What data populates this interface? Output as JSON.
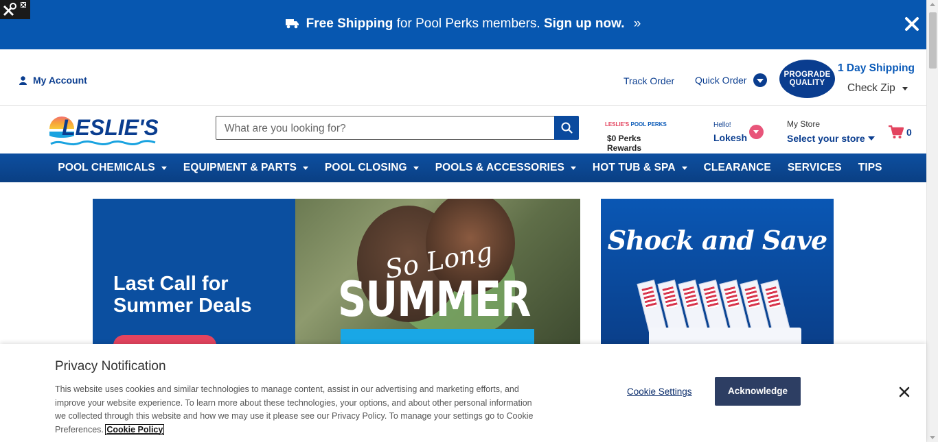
{
  "promo": {
    "free_shipping": "Free Shipping",
    "members_text": "for Pool Perks members.",
    "signup": "Sign up now.",
    "arrows": "»"
  },
  "utility": {
    "my_account": "My Account",
    "track_order": "Track Order",
    "quick_order": "Quick Order",
    "prograde_line1": "PROGRADE",
    "prograde_line2": "QUALITY",
    "one_day_shipping": "1 Day Shipping",
    "check_zip": "Check Zip"
  },
  "header": {
    "logo_text": "LESLIE'S",
    "search_placeholder": "What are you looking for?",
    "perks_brand_prefix": "LESLIE'S",
    "perks_brand_suffix": "POOL PERKS",
    "perks_rewards": "$0 Perks Rewards",
    "hello": "Hello!",
    "username": "Lokesh",
    "my_store": "My Store",
    "select_store": "Select your store",
    "cart_count": "0"
  },
  "nav": {
    "items": [
      {
        "label": "POOL CHEMICALS",
        "dropdown": true
      },
      {
        "label": "EQUIPMENT & PARTS",
        "dropdown": true
      },
      {
        "label": "POOL CLOSING",
        "dropdown": true
      },
      {
        "label": "POOLS & ACCESSORIES",
        "dropdown": true
      },
      {
        "label": "HOT TUB & SPA",
        "dropdown": true
      },
      {
        "label": "CLEARANCE",
        "dropdown": false
      },
      {
        "label": "SERVICES",
        "dropdown": false
      },
      {
        "label": "TIPS",
        "dropdown": false
      }
    ]
  },
  "hero": {
    "headline": "Last Call for Summer Deals",
    "banner_script": "So Long",
    "banner_big": "SUMMER",
    "side_banner_title": "Shock and Save"
  },
  "privacy": {
    "title": "Privacy Notification",
    "body": "This website uses cookies and similar technologies to manage content, assist in our advertising and marketing efforts, and improve your website experience. To learn more about these technologies, your options, and about other personal information we collected through this website and how we may use it please see our Privacy Policy. To manage your settings go to Cookie Preferences.",
    "cookie_policy_link": "Cookie Policy",
    "cookie_settings": "Cookie Settings",
    "acknowledge": "Acknowledge"
  },
  "colors": {
    "brand_blue": "#0757b0",
    "nav_blue": "#0a4a9e",
    "accent_pink": "#e3445f",
    "dark_button": "#2d3e63"
  }
}
